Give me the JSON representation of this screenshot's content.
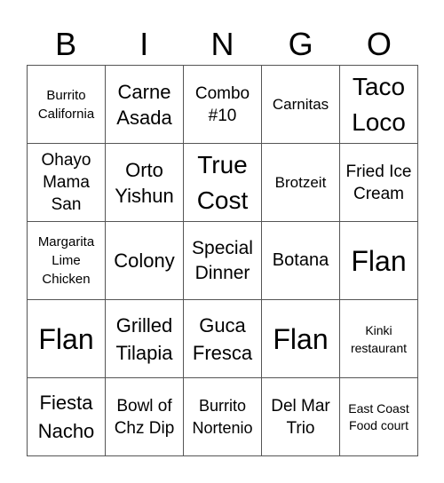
{
  "header": [
    "B",
    "I",
    "N",
    "G",
    "O"
  ],
  "cells": [
    [
      "Burrito California",
      "Carne Asada",
      "Combo #10",
      "Carnitas",
      "Taco Loco"
    ],
    [
      "Ohayo Mama San",
      "Orto Yishun",
      "True Cost",
      "Brotzeit",
      "Fried Ice Cream"
    ],
    [
      "Margarita Lime Chicken",
      "Colony",
      "Special Dinner",
      "Botana",
      "Flan"
    ],
    [
      "Flan",
      "Grilled Tilapia",
      "Guca Fresca",
      "Flan",
      "Kinki restaurant"
    ],
    [
      "Fiesta Nacho",
      "Bowl of Chz Dip",
      "Burrito Nortenio",
      "Del Mar Trio",
      "East Coast Food court"
    ]
  ]
}
